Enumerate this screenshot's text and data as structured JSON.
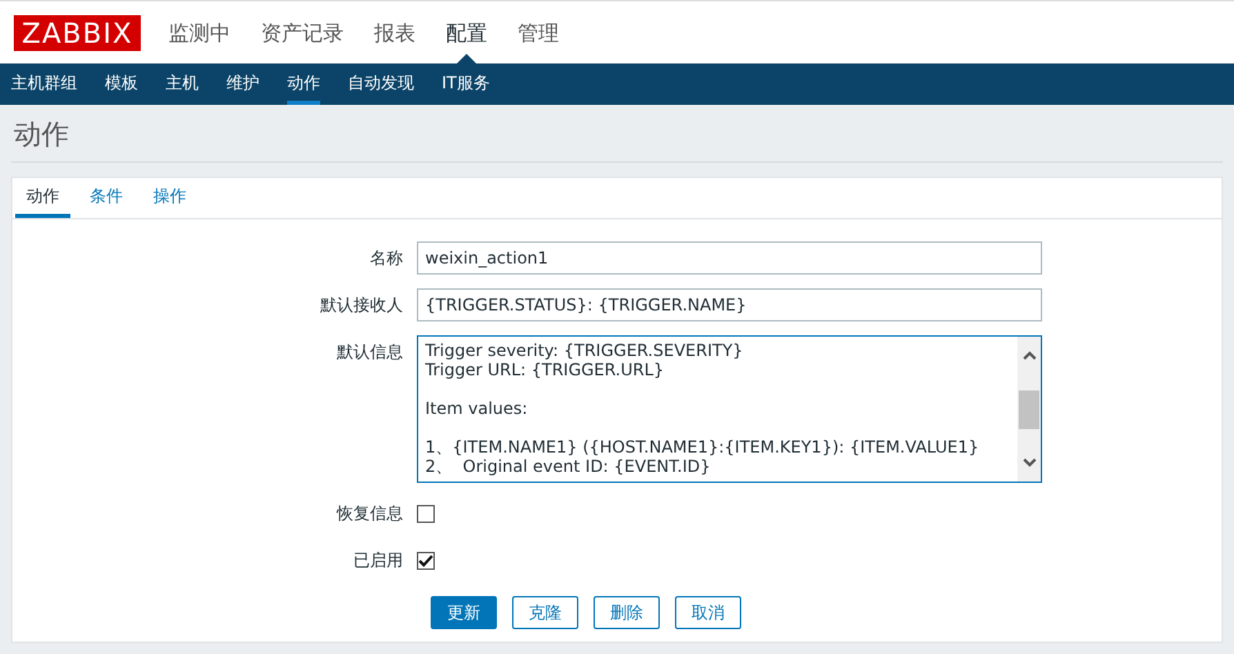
{
  "logo": "ZABBIX",
  "main_menu": [
    {
      "label": "监测中",
      "selected": false
    },
    {
      "label": "资产记录",
      "selected": false
    },
    {
      "label": "报表",
      "selected": false
    },
    {
      "label": "配置",
      "selected": true
    },
    {
      "label": "管理",
      "selected": false
    }
  ],
  "sub_menu": [
    {
      "label": "主机群组",
      "selected": false
    },
    {
      "label": "模板",
      "selected": false
    },
    {
      "label": "主机",
      "selected": false
    },
    {
      "label": "维护",
      "selected": false
    },
    {
      "label": "动作",
      "selected": true
    },
    {
      "label": "自动发现",
      "selected": false
    },
    {
      "label": "IT服务",
      "selected": false
    }
  ],
  "page_title": "动作",
  "tabs": [
    {
      "label": "动作",
      "selected": true
    },
    {
      "label": "条件",
      "selected": false
    },
    {
      "label": "操作",
      "selected": false
    }
  ],
  "form": {
    "fields": [
      {
        "kind": "input",
        "label": "名称",
        "value": "weixin_action1"
      },
      {
        "kind": "input",
        "label": "默认接收人",
        "value": "{TRIGGER.STATUS}: {TRIGGER.NAME}"
      },
      {
        "kind": "textarea",
        "label": "默认信息",
        "paragraphs": [
          [
            "Trigger severity: {TRIGGER.SEVERITY}",
            "Trigger URL: {TRIGGER.URL}"
          ],
          [
            "Item values:"
          ],
          [
            "1、{ITEM.NAME1} ({HOST.NAME1}:{ITEM.KEY1}): {ITEM.VALUE1}",
            "2、  Original event ID: {EVENT.ID}"
          ]
        ]
      },
      {
        "kind": "checkbox",
        "label": "恢复信息",
        "checked": false
      },
      {
        "kind": "checkbox",
        "label": "已启用",
        "checked": true
      }
    ],
    "buttons": [
      {
        "label": "更新",
        "primary": true
      },
      {
        "label": "克隆",
        "primary": false
      },
      {
        "label": "删除",
        "primary": false
      },
      {
        "label": "取消",
        "primary": false
      }
    ]
  }
}
